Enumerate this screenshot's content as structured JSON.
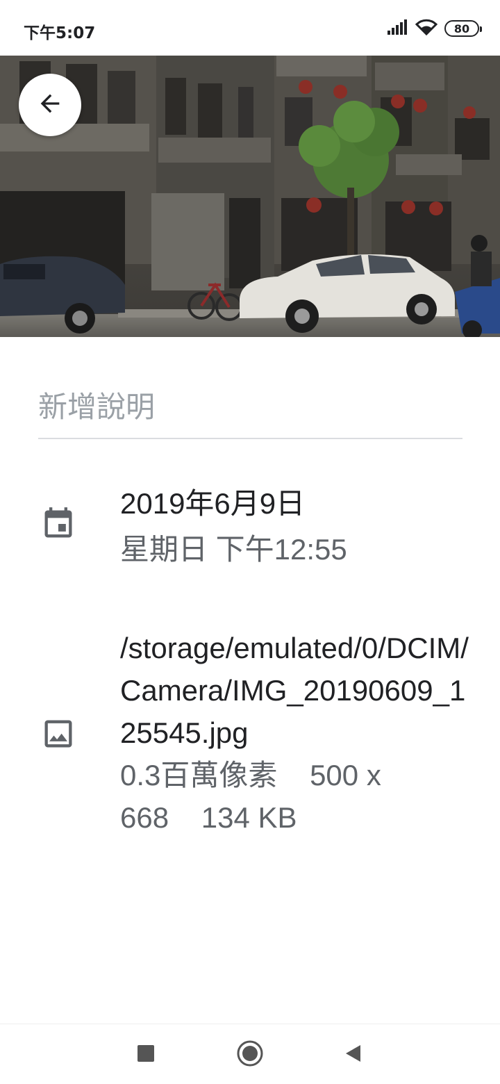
{
  "status_bar": {
    "time": "下午5:07",
    "battery": "80",
    "icons": [
      "signal-icon",
      "wifi-icon",
      "battery-icon"
    ]
  },
  "photo": {
    "alt": "street-photo"
  },
  "caption": {
    "placeholder": "新增說明",
    "value": ""
  },
  "date_detail": {
    "icon": "calendar-icon",
    "date": "2019年6月9日",
    "time": "星期日 下午12:55"
  },
  "file_detail": {
    "icon": "image-icon",
    "path": "/storage/emulated/0/DCIM/Camera/IMG_20190609_125545.jpg",
    "megapixels": "0.3百萬像素",
    "dimensions_line1": "500 x",
    "dimensions_line2": "668",
    "size": "134 KB"
  },
  "nav_bar": {
    "icons": [
      "recents-icon",
      "home-icon",
      "back-icon"
    ]
  },
  "colors": {
    "text_primary": "#202124",
    "text_secondary": "#5f6368",
    "placeholder": "#9aa0a6",
    "divider": "#dadce0",
    "icon": "#5f6368",
    "nav_icon": "#555555"
  }
}
